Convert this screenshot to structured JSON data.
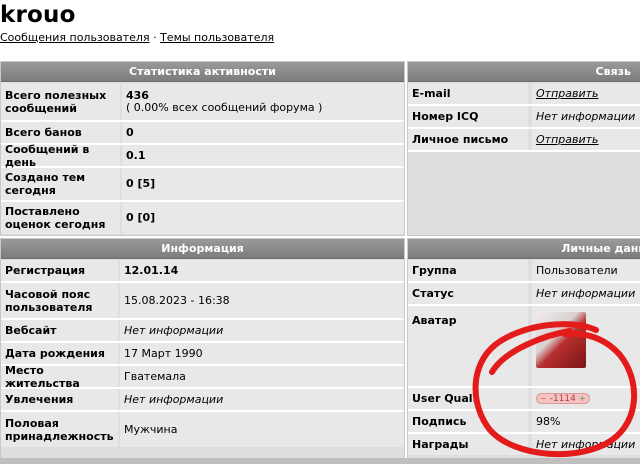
{
  "profile": {
    "username": "krouo",
    "links": [
      "Сообщения пользователя",
      "Темы пользователя"
    ],
    "separator": "·"
  },
  "stats": {
    "header": "Статистика активности",
    "rows": [
      {
        "label": "Всего полезных сообщений",
        "value": "436",
        "sub": "( 0.00% всех сообщений форума )"
      },
      {
        "label": "Всего банов",
        "value": "0"
      },
      {
        "label": "Сообщений в день",
        "value": "0.1"
      },
      {
        "label": "Создано тем сегодня",
        "value": "0 [5]"
      },
      {
        "label": "Поставлено оценок сегодня",
        "value": "0 [0]"
      }
    ]
  },
  "contact": {
    "header": "Связь",
    "rows": [
      {
        "label": "E-mail",
        "value": "Отправить"
      },
      {
        "label": "Номер ICQ",
        "value": "Нет информации"
      },
      {
        "label": "Личное письмо",
        "value": "Отправить"
      }
    ]
  },
  "info": {
    "header": "Информация",
    "rows": [
      {
        "label": "Регистрация",
        "value": "12.01.14"
      },
      {
        "label": "Часовой пояс пользователя",
        "value": "15.08.2023 - 16:38"
      },
      {
        "label": "Вебсайт",
        "value": "Нет информации"
      },
      {
        "label": "Дата рождения",
        "value": "17 Март 1990"
      },
      {
        "label": "Место жительства",
        "value": "Гватемала"
      },
      {
        "label": "Увлечения",
        "value": "Нет информации"
      },
      {
        "label": "Половая принадлежность",
        "value": "Мужчина"
      }
    ]
  },
  "personal": {
    "header": "Личные данн",
    "rows": [
      {
        "label": "Группа",
        "value": "Пользователи"
      },
      {
        "label": "Статус",
        "value": "Нет информации"
      },
      {
        "label": "Аватар",
        "value": ""
      },
      {
        "label": "User Quali",
        "value": "-1114"
      },
      {
        "label": "Подпись",
        "value": "98%"
      },
      {
        "label": "Награды",
        "value": "Нет информации"
      }
    ]
  },
  "colors": {
    "scribble": "#e31b1b"
  }
}
